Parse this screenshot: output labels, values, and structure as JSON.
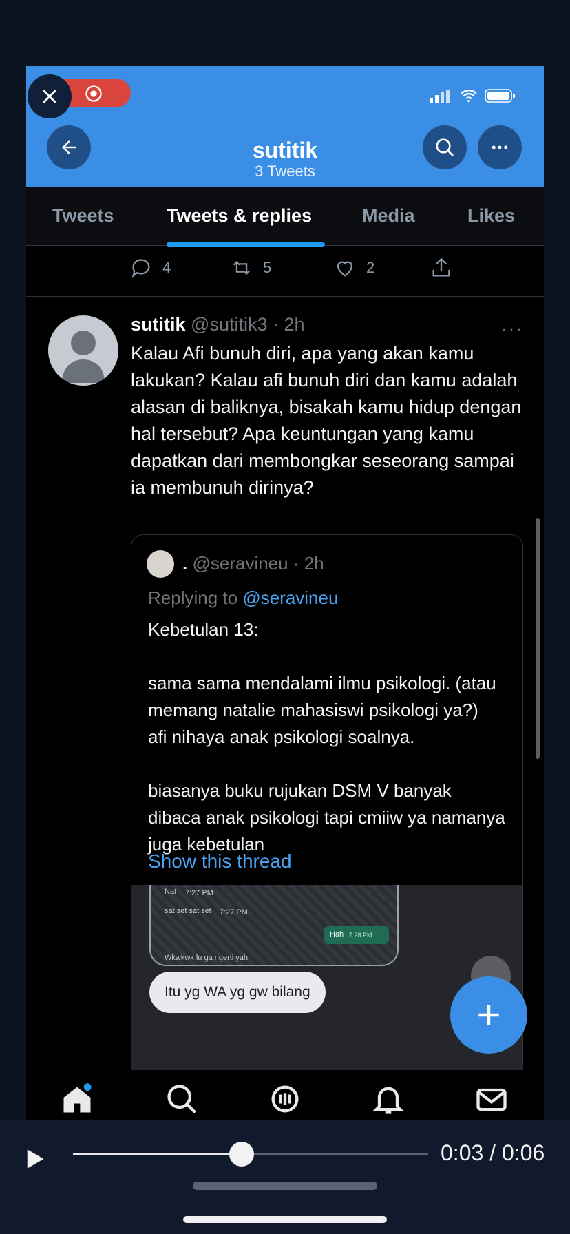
{
  "profile": {
    "name": "sutitik",
    "tweet_count": "3 Tweets"
  },
  "tabs": [
    {
      "label": "Tweets"
    },
    {
      "label": "Tweets & replies"
    },
    {
      "label": "Media"
    },
    {
      "label": "Likes"
    }
  ],
  "prev_actions": {
    "replies": "4",
    "retweets": "5",
    "likes": "2"
  },
  "tweet": {
    "name": "sutitik",
    "handle_time": "@sutitik3 · 2h",
    "more": "···",
    "text": "Kalau Afi bunuh diri, apa yang akan kamu lakukan? Kalau afi bunuh diri dan kamu adalah alasan di baliknya, bisakah kamu hidup dengan hal tersebut? Apa keuntungan yang kamu dapatkan dari membongkar seseorang sampai ia membunuh dirinya?"
  },
  "quote": {
    "dot": ".",
    "handle_time": "@seravineu · 2h",
    "replying_prefix": "Replying to",
    "replying_mention": "@seravineu",
    "body": "Kebetulan 13:\n\nsama sama mendalami ilmu psikologi. (atau memang natalie mahasiswi psikologi ya?)\nafi nihaya anak psikologi soalnya.\n\nbiasanya buku rujukan DSM V banyak dibaca anak psikologi tapi cmiiw ya namanya juga kebetulan",
    "show_thread": "Show this thread",
    "chat": {
      "line1": "Nat",
      "time1": "7:27 PM",
      "line2": "sat set sat set",
      "time2": "7:27 PM",
      "green": "Hah",
      "green_time": "7:28 PM",
      "line3": "Wkwkwk lu ga ngerti yah"
    },
    "wa_bubble": "Itu yg WA yg gw bilang"
  },
  "player": {
    "time": "0:03 / 0:06",
    "progress": 0.5
  },
  "colors": {
    "accent": "#3a8ee6",
    "link": "#4aa3f0",
    "record": "#d9453d"
  },
  "icons": [
    "close-icon",
    "record-icon",
    "back-arrow-icon",
    "search-icon",
    "more-icon",
    "reply-icon",
    "retweet-icon",
    "heart-icon",
    "share-icon",
    "plus-icon",
    "home-icon",
    "spaces-icon",
    "bell-icon",
    "mail-icon",
    "play-icon"
  ]
}
